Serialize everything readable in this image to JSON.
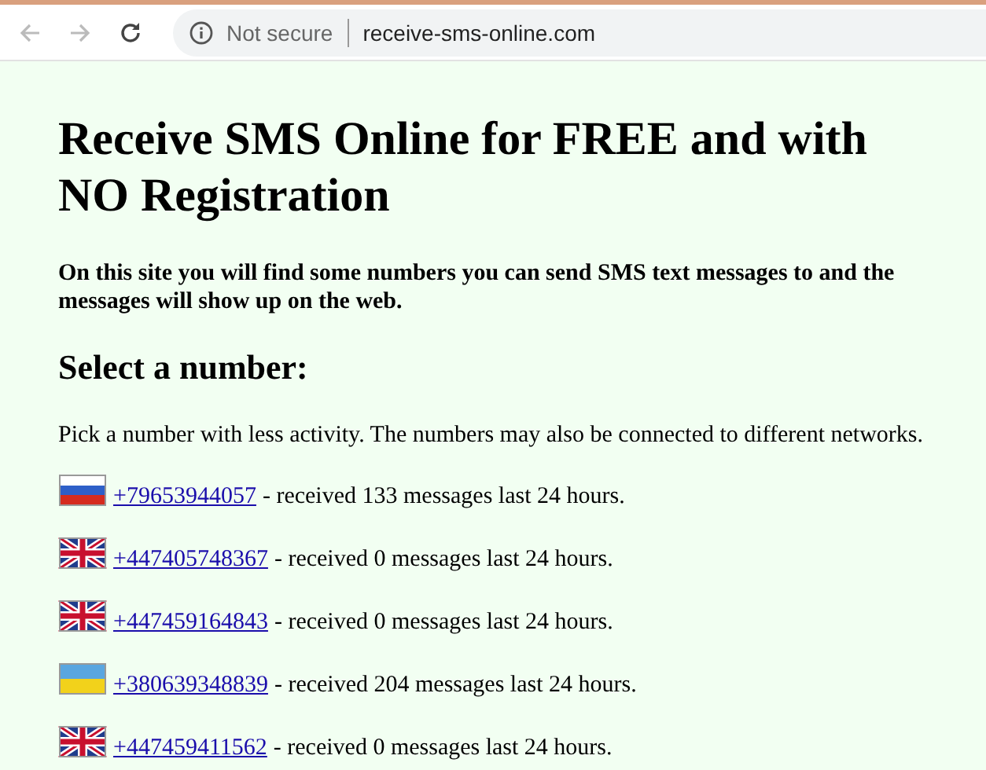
{
  "browser": {
    "security": "Not secure",
    "url": "receive-sms-online.com"
  },
  "heading": "Receive SMS Online for FREE and with NO Registration",
  "intro": "On this site you will find some numbers you can send SMS text messages to and the messages will show up on the web.",
  "subheading": "Select a number:",
  "note": "Pick a number with less activity. The numbers may also be connected to different networks.",
  "numbers": [
    {
      "kind": "ru",
      "number": "+79653944057",
      "info": "- received 133 messages last 24 hours."
    },
    {
      "kind": "gb",
      "number": "+447405748367",
      "info": "- received 0 messages last 24 hours."
    },
    {
      "kind": "gb",
      "number": "+447459164843",
      "info": "- received 0 messages last 24 hours."
    },
    {
      "kind": "ua",
      "number": "+380639348839",
      "info": "- received 204 messages last 24 hours."
    },
    {
      "kind": "gb",
      "number": "+447459411562",
      "info": "- received 0 messages last 24 hours."
    }
  ]
}
